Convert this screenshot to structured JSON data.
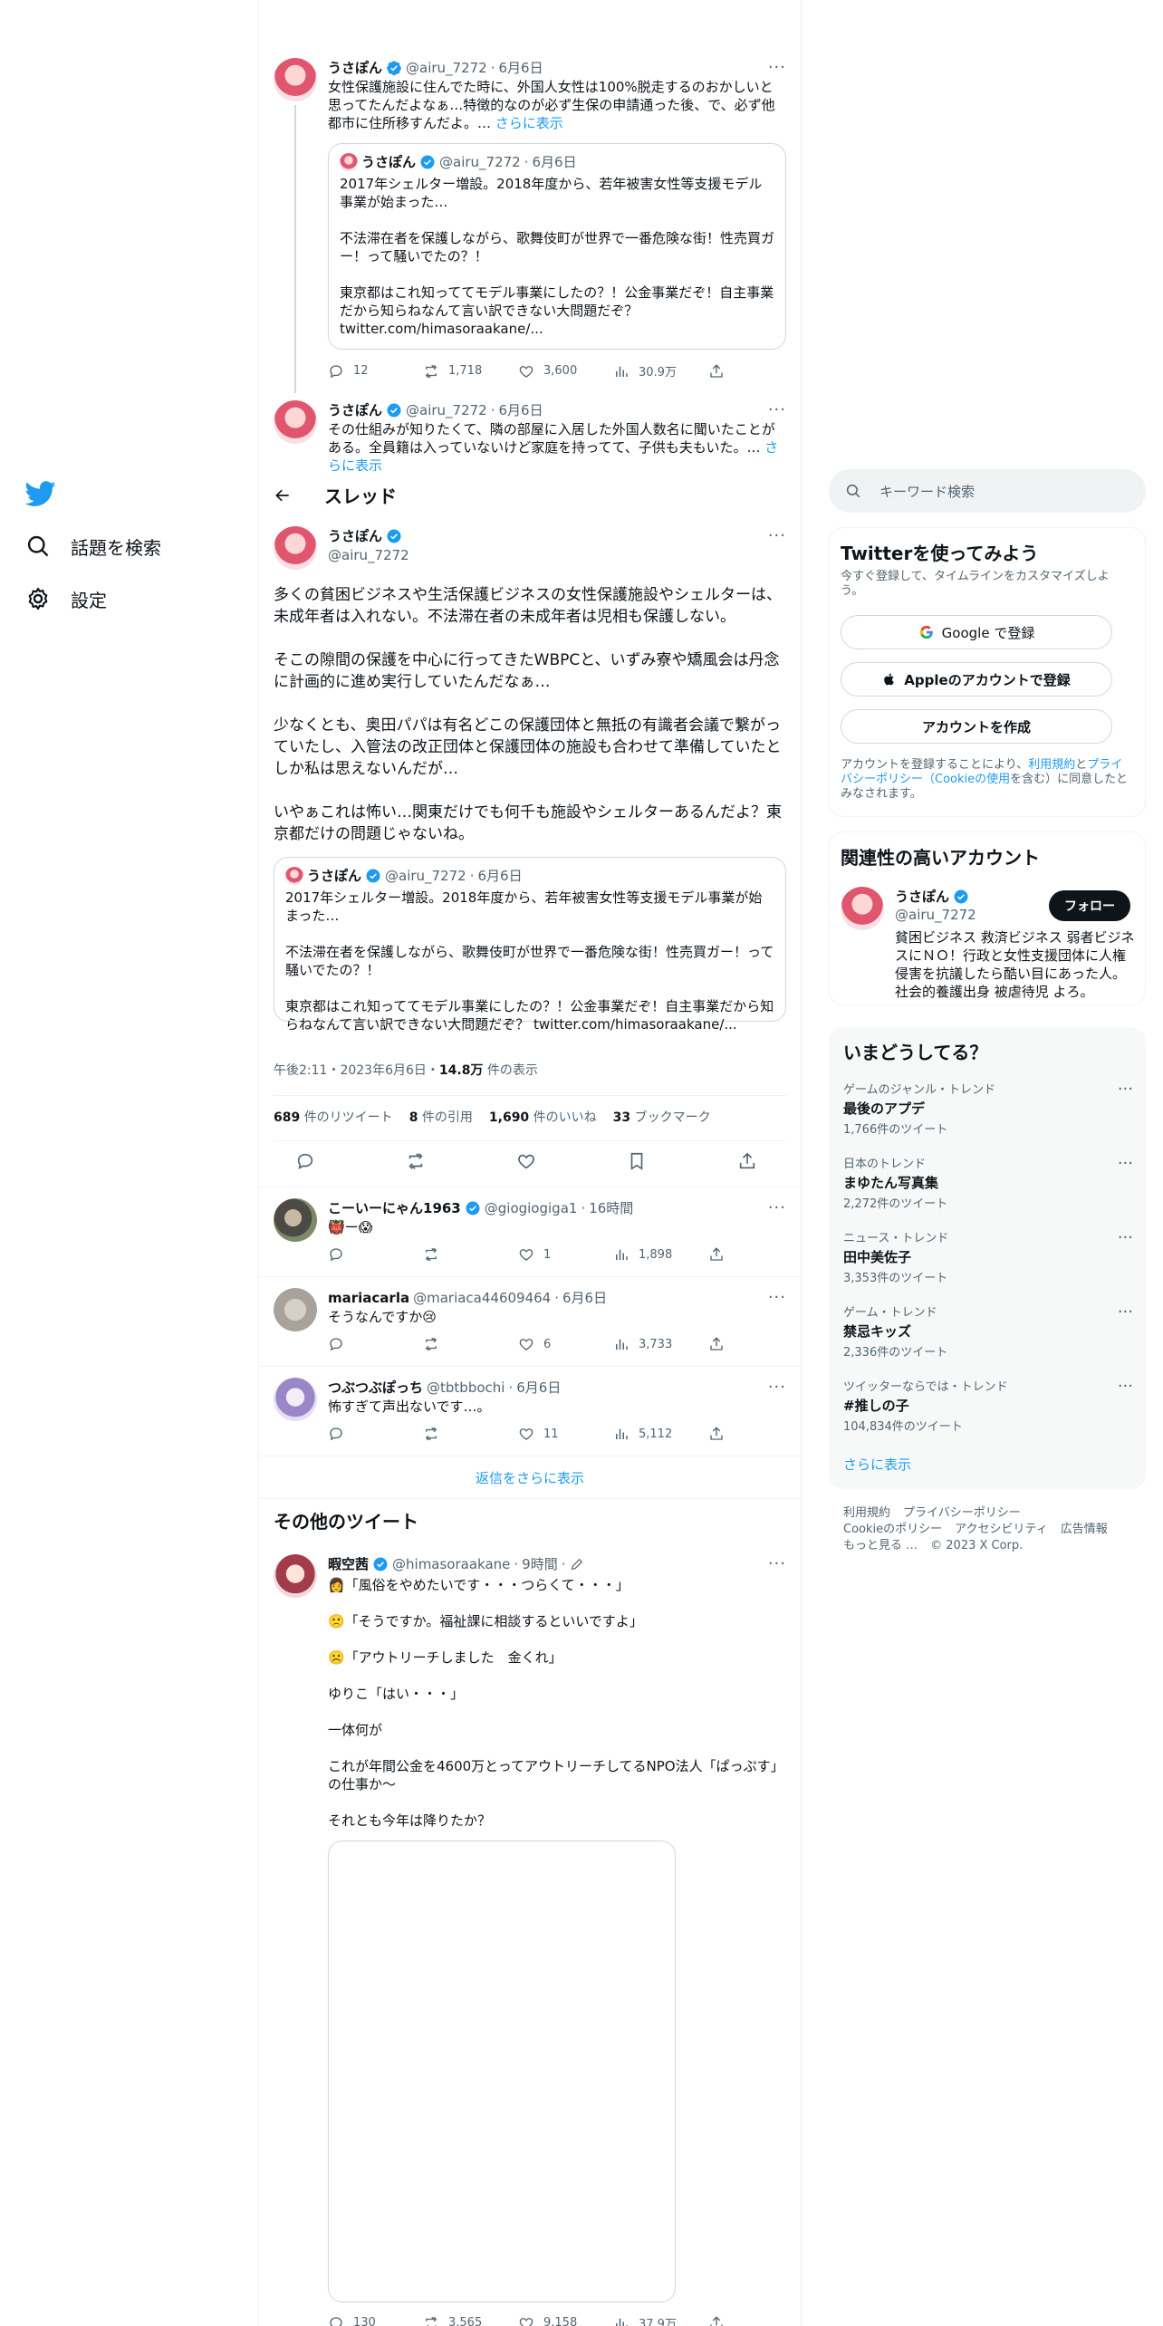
{
  "nav": {
    "explore_label": "話題を検索",
    "settings_label": "設定"
  },
  "thread_header": {
    "title": "スレッド"
  },
  "prev_tweet_1": {
    "name": "うさぽん",
    "handle": "@airu_7272",
    "date": "6月6日",
    "text": "女性保護施設に住んでた時に、外国人女性は100%脱走するのおかしいと思ってたんだよなぁ…特徴的なのが必ず生保の申請通った後、で、必ず他都市に住所移すんだよ。…",
    "show_more": "さらに表示",
    "quote": {
      "name": "うさぽん",
      "handle": "@airu_7272",
      "date": "6月6日",
      "text": "2017年シェルター増設。2018年度から、若年被害女性等支援モデル事業が始まった…\n\n不法滞在者を保護しながら、歌舞伎町が世界で一番危険な街！性売買ガー！って騒いでたの？！\n\n東京都はこれ知っててモデル事業にしたの？！公金事業だぞ！自主事業だから知らねなんて言い訳できない大問題だぞ？\ntwitter.com/himasoraakane/..."
    },
    "replies": "12",
    "retweets": "1,718",
    "likes": "3,600",
    "views": "30.9万"
  },
  "prev_tweet_2": {
    "name": "うさぽん",
    "handle": "@airu_7272",
    "date": "6月6日",
    "text": "その仕組みが知りたくて、隣の部屋に入居した外国人数名に聞いたことがある。全員籍は入っていないけど家庭を持ってて、子供も夫もいた。…",
    "show_more": "さらに表示"
  },
  "main_tweet": {
    "name": "うさぽん",
    "handle": "@airu_7272",
    "text": "多くの貧困ビジネスや生活保護ビジネスの女性保護施設やシェルターは、未成年者は入れない。不法滞在者の未成年者は児相も保護しない。\n\nそこの隙間の保護を中心に行ってきたWBPCと、いずみ寮や矯風会は丹念に計画的に進め実行していたんだなぁ…\n\n少なくとも、奥田パパは有名どこの保護団体と無抵の有識者会議で繋がっていたし、入管法の改正団体と保護団体の施設も合わせて準備していたとしか私は思えないんだが…\n\nいやぁこれは怖い…関東だけでも何千も施設やシェルターあるんだよ？東京都だけの問題じゃないね。",
    "quote": {
      "name": "うさぽん",
      "handle": "@airu_7272",
      "date": "6月6日",
      "text": "2017年シェルター増設。2018年度から、若年被害女性等支援モデル事業が始まった…\n\n不法滞在者を保護しながら、歌舞伎町が世界で一番危険な街！性売買ガー！って騒いでたの？！\n\n東京都はこれ知っててモデル事業にしたの？！公金事業だぞ！自主事業だから知らねなんて言い訳できない大問題だぞ？ twitter.com/himasoraakane/..."
    },
    "timestamp": "午後2:11・2023年6月6日・",
    "views_count": "14.8万",
    "views_label": "件の表示",
    "retweets_count": "689",
    "retweets_label": "件のリツイート",
    "quotes_count": "8",
    "quotes_label": "件の引用",
    "likes_count": "1,690",
    "likes_label": "件のいいね",
    "bookmarks_count": "33",
    "bookmarks_label": "ブックマーク"
  },
  "replies": [
    {
      "name": "こーいーにゃん1963",
      "handle": "@giogiogiga1",
      "date": "16時間",
      "text": "👹ー😱",
      "replies": "",
      "retweets": "",
      "likes": "1",
      "views": "1,898"
    },
    {
      "name": "mariacarla",
      "handle": "@mariaca44609464",
      "date": "6月6日",
      "text": "そうなんですか😢",
      "replies": "",
      "retweets": "",
      "likes": "6",
      "views": "3,733"
    },
    {
      "name": "つぶつぶぽっち",
      "handle": "@tbtbbochi",
      "date": "6月6日",
      "text": "怖すぎて声出ないです…。",
      "replies": "",
      "retweets": "",
      "likes": "11",
      "views": "5,112"
    }
  ],
  "more_replies_label": "返信をさらに表示",
  "other_tweets_header": "その他のツイート",
  "other_tweet": {
    "name": "暇空茜",
    "handle": "@himasoraakane",
    "date": "9時間",
    "text": "👩「風俗をやめたいです・・・つらくて・・・」\n\n🙁「そうですか。福祉課に相談するといいですよ」\n\n☹️「アウトリーチしました　金くれ」\n\nゆりこ「はい・・・」\n\n一体何が\n\nこれが年間公金を4600万とってアウトリーチしてるNPO法人「ぱっぷす」の仕事か～\n\nそれとも今年は降りたか？",
    "replies": "130",
    "retweets": "3,565",
    "likes": "9,158",
    "views": "37.9万"
  },
  "right": {
    "search_placeholder": "キーワード検索",
    "signup": {
      "title": "Twitterを使ってみよう",
      "subtitle": "今すぐ登録して、タイムラインをカスタマイズしよう。",
      "google_label": "Google で登録",
      "apple_label": "Appleのアカウントで登録",
      "create_label": "アカウントを作成",
      "legal_pre": "アカウントを登録することにより、",
      "legal_terms": "利用規約",
      "legal_and": "と",
      "legal_privacy": "プライバシーポリシー（Cookieの使用",
      "legal_post": "を含む）に同意したとみなされます。"
    },
    "related": {
      "title": "関連性の高いアカウント",
      "name": "うさぽん",
      "handle": "@airu_7272",
      "follow_label": "フォロー",
      "bio": "貧困ビジネス 救済ビジネス 弱者ビジネスにＮＯ！行政と女性支援団体に人権侵害を抗議したら酷い目にあった人。社会的養護出身 被虐待児 よろ。"
    },
    "trends": {
      "title": "いまどうしてる？",
      "items": [
        {
          "category": "ゲームのジャンル・トレンド",
          "name": "最後のアプデ",
          "count": "1,766件のツイート"
        },
        {
          "category": "日本のトレンド",
          "name": "まゆたん写真集",
          "count": "2,272件のツイート"
        },
        {
          "category": "ニュース・トレンド",
          "name": "田中美佐子",
          "count": "3,353件のツイート"
        },
        {
          "category": "ゲーム・トレンド",
          "name": "禁忌キッズ",
          "count": "2,336件のツイート"
        },
        {
          "category": "ツイッターならでは・トレンド",
          "name": "#推しの子",
          "count": "104,834件のツイート"
        }
      ],
      "show_more": "さらに表示"
    },
    "footer": {
      "terms": "利用規約",
      "privacy": "プライバシーポリシー",
      "cookie": "Cookieのポリシー",
      "accessibility": "アクセシビリティ",
      "ads": "広告情報",
      "more": "もっと見る …",
      "copyright": "© 2023 X Corp."
    }
  }
}
